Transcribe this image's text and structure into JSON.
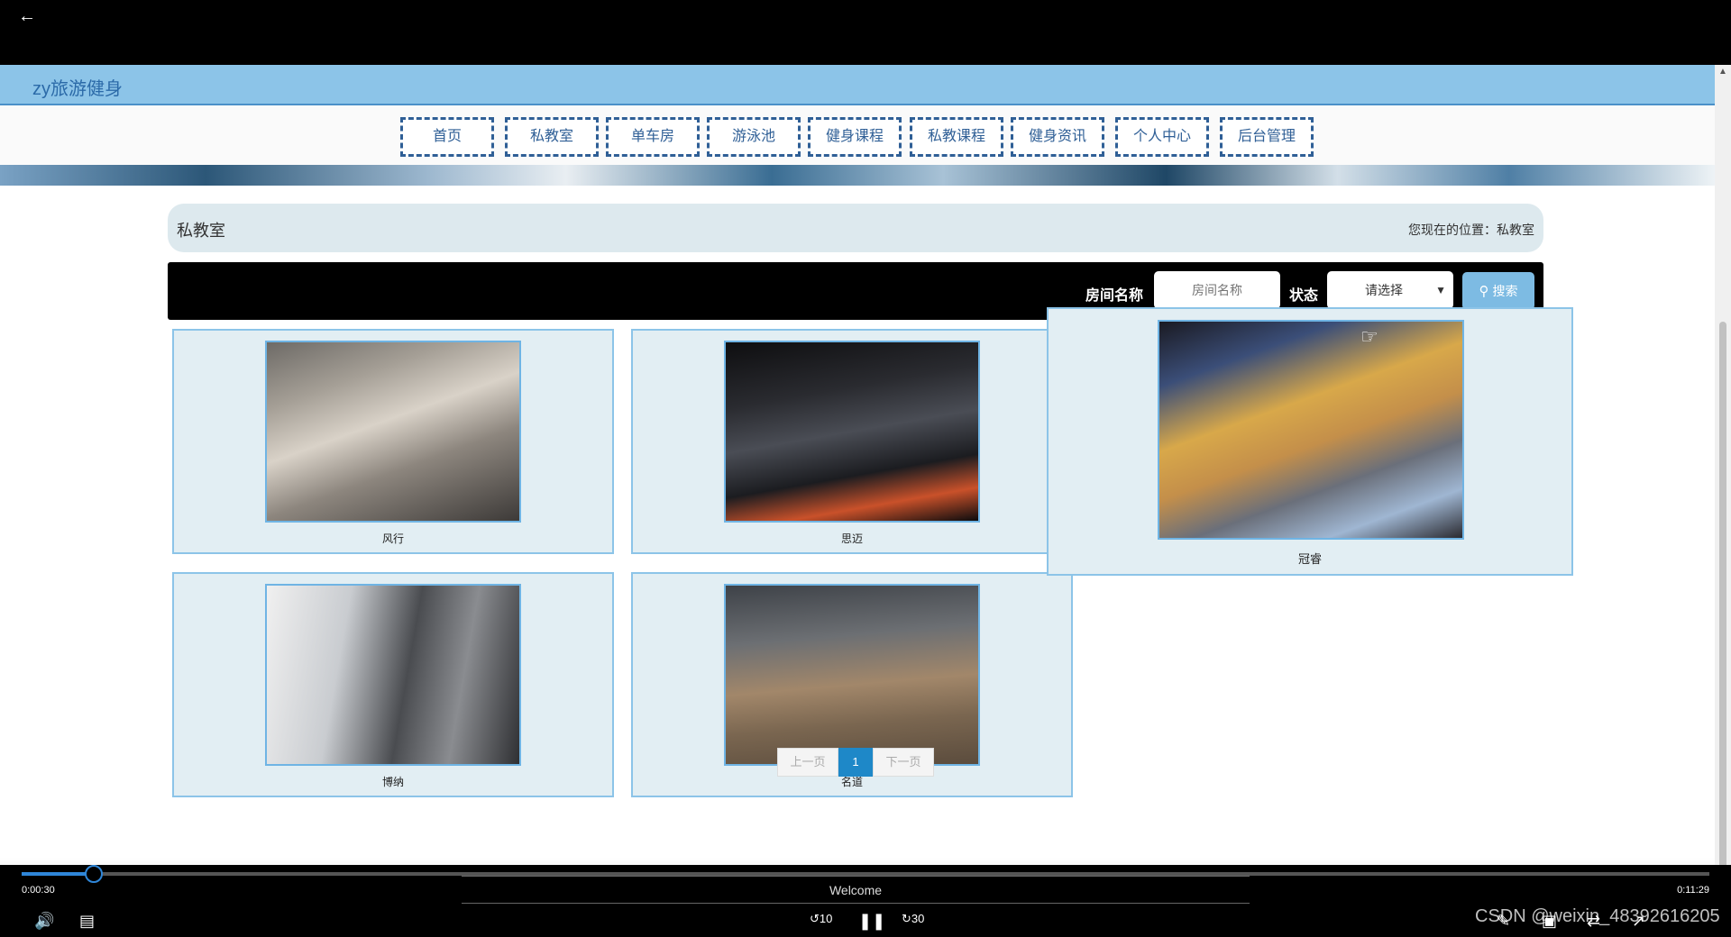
{
  "player": {
    "current_time": "0:00:30",
    "total_time": "0:11:29",
    "progress": 0.043,
    "caption": "Welcome",
    "watermark": "CSDN @weixin_48392616205",
    "rewind_label": "10",
    "forward_label": "30"
  },
  "site": {
    "title": "zy旅游健身"
  },
  "nav": [
    {
      "label": "首页"
    },
    {
      "label": "私教室"
    },
    {
      "label": "单车房"
    },
    {
      "label": "游泳池"
    },
    {
      "label": "健身课程"
    },
    {
      "label": "私教课程"
    },
    {
      "label": "健身资讯"
    },
    {
      "label": "个人中心"
    },
    {
      "label": "后台管理"
    }
  ],
  "page": {
    "title": "私教室",
    "location_label": "您现在的位置：私教室"
  },
  "search": {
    "room_label": "房间名称",
    "room_placeholder": "房间名称",
    "status_label": "状态",
    "status_selected": "请选择",
    "button_label": "搜索"
  },
  "rooms": [
    {
      "name": "风行"
    },
    {
      "name": "思迈"
    },
    {
      "name": "冠睿"
    },
    {
      "name": "博纳"
    },
    {
      "name": "名道"
    }
  ],
  "pagination": {
    "prev": "上一页",
    "current": "1",
    "next": "下一页"
  },
  "colors": {
    "header": "#8cc4e8",
    "nav_border": "#2f5f96",
    "card_bg": "#e2eef3",
    "accent": "#1e88c8"
  }
}
